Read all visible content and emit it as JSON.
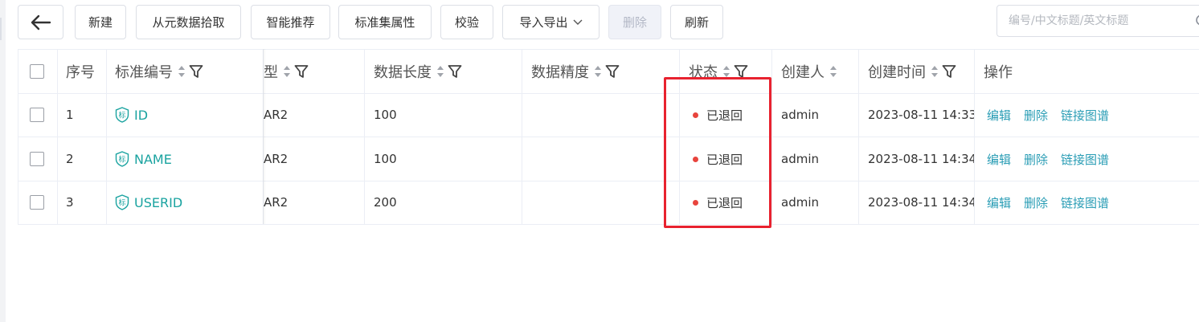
{
  "toolbar": {
    "back_icon": "arrow-left-icon",
    "buttons": [
      "新建",
      "从元数据拾取",
      "智能推荐",
      "标准集属性",
      "校验",
      "导入导出",
      "删除",
      "刷新"
    ],
    "search_placeholder": "编号/中文标题/英文标题"
  },
  "table": {
    "columns": [
      "序号",
      "标准编号",
      "型",
      "数据长度",
      "数据精度",
      "状态",
      "创建人",
      "创建时间",
      "操作"
    ],
    "rows": [
      {
        "index": "1",
        "code": "ID",
        "type": "AR2",
        "length": "100",
        "precision": "",
        "status": "已退回",
        "creator": "admin",
        "created": "2023-08-11 14:33"
      },
      {
        "index": "2",
        "code": "NAME",
        "type": "AR2",
        "length": "100",
        "precision": "",
        "status": "已退回",
        "creator": "admin",
        "created": "2023-08-11 14:34"
      },
      {
        "index": "3",
        "code": "USERID",
        "type": "AR2",
        "length": "200",
        "precision": "",
        "status": "已退回",
        "creator": "admin",
        "created": "2023-08-11 14:34"
      }
    ],
    "actions": [
      "编辑",
      "删除",
      "链接图谱"
    ],
    "code_badge": "标"
  },
  "colors": {
    "accent": "#1aa3a0",
    "action_link": "#2a9db5",
    "status_dot": "#e8443d",
    "highlight_border": "#e8222f"
  }
}
